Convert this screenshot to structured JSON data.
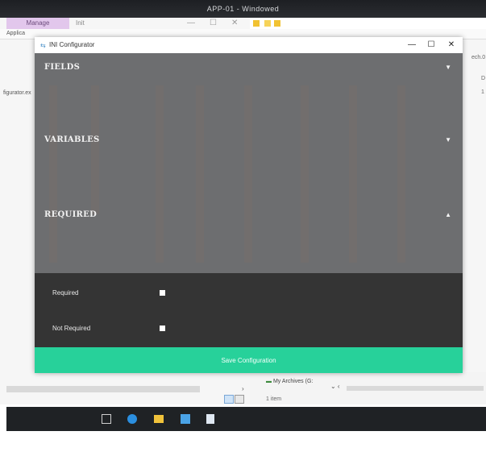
{
  "remote_window": {
    "title": "APP-01 - Windowed"
  },
  "background_explorer": {
    "manage_tab": "Manage",
    "second_tab": "Init",
    "application_label": "Applica",
    "left_filename": "figurator.ex",
    "right_path_fragment": "ech.0",
    "right_col_d": "D",
    "right_col_1": "1",
    "nav_item": "My Archives (G:",
    "status_items": "1 item",
    "minimize_glyph": "—",
    "maximize_glyph": "☐",
    "close_glyph": "✕"
  },
  "app_window": {
    "title": "INI Configurator",
    "minimize_glyph": "—",
    "maximize_glyph": "☐",
    "close_glyph": "✕"
  },
  "sections": [
    {
      "label": "FIELDS",
      "caret": "▼"
    },
    {
      "label": "VARIABLES",
      "caret": "▼"
    },
    {
      "label": "REQUIRED",
      "caret": "▲"
    }
  ],
  "required_options": [
    {
      "label": "Required",
      "checked": false
    },
    {
      "label": "Not Required",
      "checked": false
    }
  ],
  "save_button": {
    "label": "Save Configuration"
  },
  "colors": {
    "app_body": "#6d6e70",
    "required_panel": "#343434",
    "save_button": "#27d19a",
    "taskbar": "#1f2225"
  },
  "taskbar_icons": [
    "task-view-icon",
    "edge-icon",
    "file-explorer-icon",
    "server-manager-icon",
    "app-icon"
  ]
}
